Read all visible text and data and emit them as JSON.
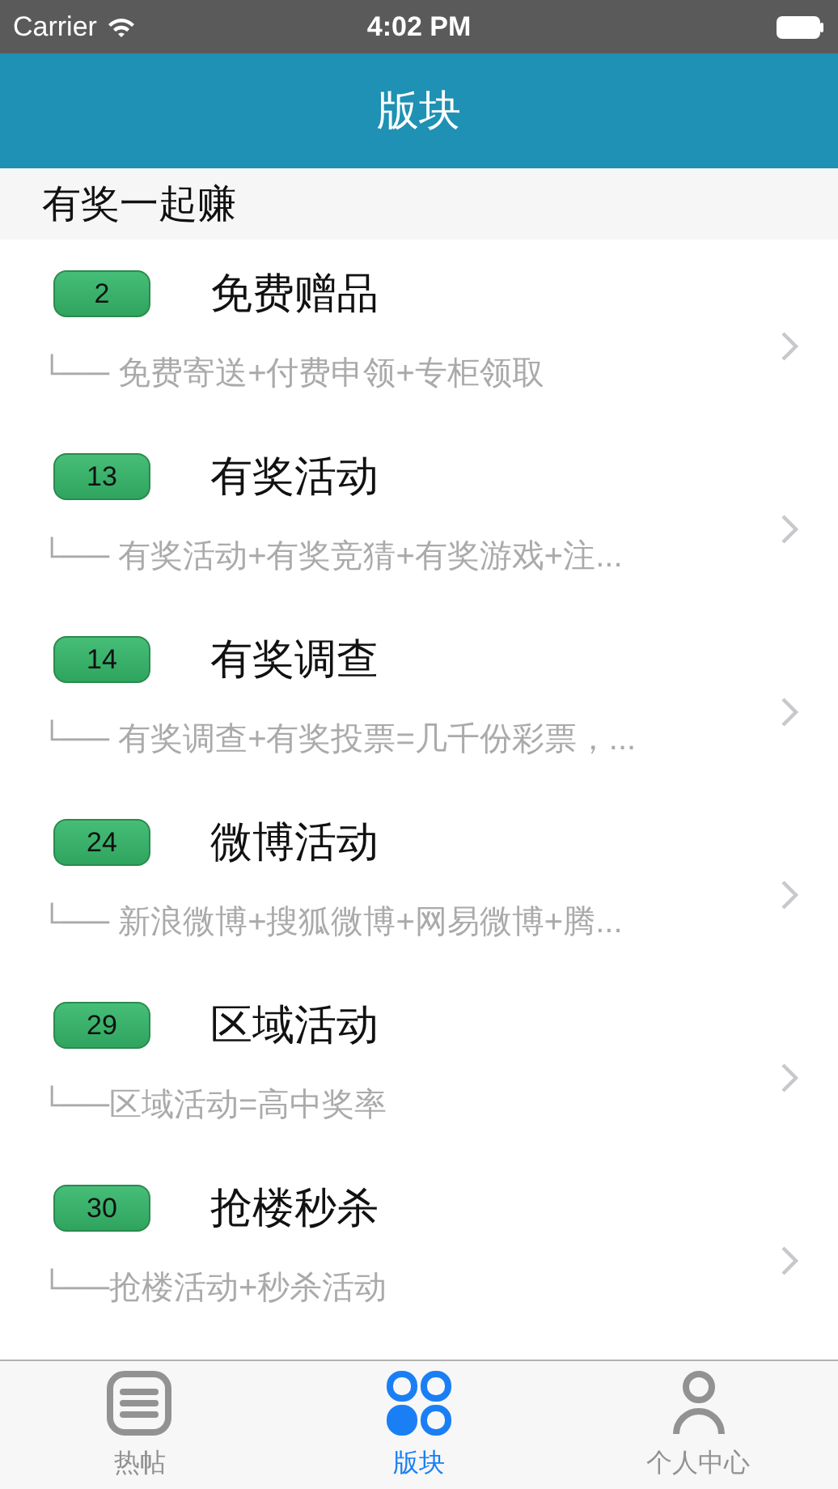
{
  "status_bar": {
    "carrier": "Carrier",
    "time": "4:02 PM"
  },
  "nav_bar": {
    "title": "版块"
  },
  "section": {
    "title": "有奖一起赚"
  },
  "rows": [
    {
      "count": "2",
      "title": "免费赠品",
      "subtitle": "└── 免费寄送+付费申领+专柜领取"
    },
    {
      "count": "13",
      "title": "有奖活动",
      "subtitle": "└── 有奖活动+有奖竞猜+有奖游戏+注..."
    },
    {
      "count": "14",
      "title": "有奖调查",
      "subtitle": "└── 有奖调查+有奖投票=几千份彩票，..."
    },
    {
      "count": "24",
      "title": "微博活动",
      "subtitle": "└── 新浪微博+搜狐微博+网易微博+腾..."
    },
    {
      "count": "29",
      "title": "区域活动",
      "subtitle": "└──区域活动=高中奖率"
    },
    {
      "count": "30",
      "title": "抢楼秒杀",
      "subtitle": "└──抢楼活动+秒杀活动"
    }
  ],
  "tabs": [
    {
      "label": "热帖",
      "selected": false
    },
    {
      "label": "版块",
      "selected": true
    },
    {
      "label": "个人中心",
      "selected": false
    }
  ]
}
